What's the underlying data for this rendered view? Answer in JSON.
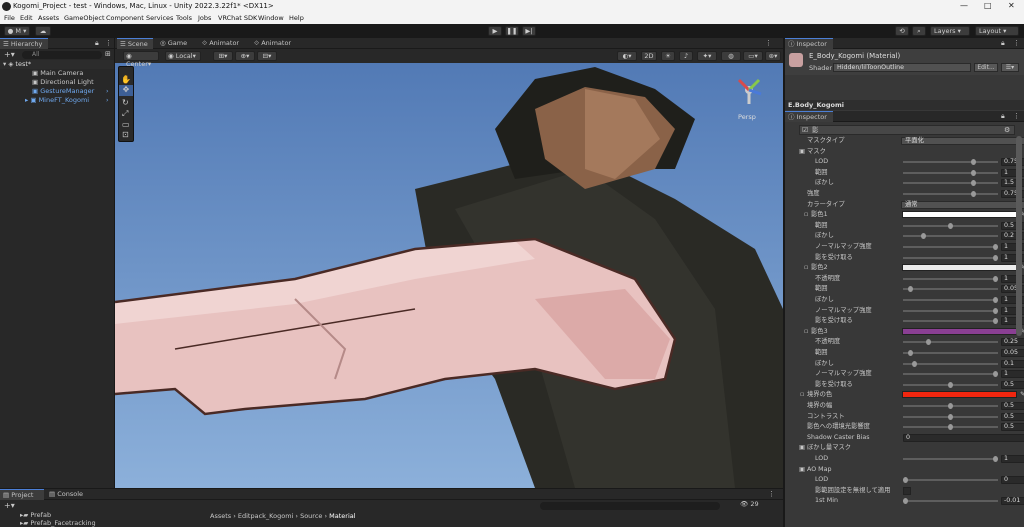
{
  "window": {
    "title": "Kogomi_Project - test - Windows, Mac, Linux - Unity 2022.3.22f1* <DX11>",
    "minimize": "—",
    "maximize": "□",
    "close": "✕"
  },
  "menu": [
    "File",
    "Edit",
    "Assets",
    "GameObject",
    "Component",
    "Services",
    "Tools",
    "Jobs",
    "VRChat SDK",
    "Window",
    "Help"
  ],
  "toolbar": {
    "account": "M",
    "layers": "Layers",
    "layout": "Layout"
  },
  "hierarchy": {
    "tab": "Hierarchy",
    "search_placeholder": "All",
    "items": [
      {
        "label": "test*",
        "indent": 0
      },
      {
        "label": "Main Camera",
        "indent": 1
      },
      {
        "label": "Directional Light",
        "indent": 1
      },
      {
        "label": "GestureManager",
        "indent": 1
      },
      {
        "label": "MineFT_Kogomi",
        "indent": 1
      }
    ]
  },
  "scene_tabs": [
    "Scene",
    "Game",
    "Animator",
    "Animator"
  ],
  "scene_toolbar": {
    "pivot": "Center",
    "space": "Local",
    "mode_2d": "2D",
    "persp": "Persp",
    "gizmo_count": "29"
  },
  "inspector_top": {
    "tab": "Inspector",
    "material_name": "E_Body_Kogomi (Material)",
    "shader_label": "Shader",
    "shader_value": "Hidden/lilToonOutline",
    "edit": "Edit...",
    "object_name": "E.Body_Kogomi"
  },
  "inspector": {
    "tab": "Inspector",
    "section": "影",
    "rows": [
      {
        "label": "マスクタイプ",
        "type": "dropdown",
        "value": "平面化",
        "indent": 1
      },
      {
        "label": "マスク",
        "type": "header",
        "indent": 1
      },
      {
        "label": "LOD",
        "type": "slider",
        "value": "0.75",
        "pos": 0.75,
        "indent": 3
      },
      {
        "label": "範囲",
        "type": "slider",
        "value": "1",
        "pos": 0.75,
        "indent": 3
      },
      {
        "label": "ぼかし",
        "type": "slider",
        "value": "1.5",
        "pos": 0.75,
        "indent": 3
      },
      {
        "label": "強度",
        "type": "slider",
        "value": "0.75",
        "pos": 0.75,
        "indent": 1
      },
      {
        "label": "カラータイプ",
        "type": "dropdown",
        "value": "通常",
        "indent": 1
      },
      {
        "label": "影色1",
        "type": "color",
        "color": "#ffffff",
        "indent": 2
      },
      {
        "label": "範囲",
        "type": "slider",
        "value": "0.5",
        "pos": 0.5,
        "indent": 3
      },
      {
        "label": "ぼかし",
        "type": "slider",
        "value": "0.2",
        "pos": 0.2,
        "indent": 3
      },
      {
        "label": "ノーマルマップ強度",
        "type": "slider",
        "value": "1",
        "pos": 1,
        "indent": 3
      },
      {
        "label": "影を受け取る",
        "type": "slider",
        "value": "1",
        "pos": 1,
        "indent": 3
      },
      {
        "label": "影色2",
        "type": "color",
        "color": "#ececec",
        "indent": 2
      },
      {
        "label": "不透明度",
        "type": "slider",
        "value": "1",
        "pos": 1,
        "indent": 3
      },
      {
        "label": "範囲",
        "type": "slider",
        "value": "0.05",
        "pos": 0.05,
        "indent": 3
      },
      {
        "label": "ぼかし",
        "type": "slider",
        "value": "1",
        "pos": 1,
        "indent": 3
      },
      {
        "label": "ノーマルマップ強度",
        "type": "slider",
        "value": "1",
        "pos": 1,
        "indent": 3
      },
      {
        "label": "影を受け取る",
        "type": "slider",
        "value": "1",
        "pos": 1,
        "indent": 3
      },
      {
        "label": "影色3",
        "type": "color",
        "color": "#8a3f93",
        "indent": 2
      },
      {
        "label": "不透明度",
        "type": "slider",
        "value": "0.25",
        "pos": 0.25,
        "indent": 3
      },
      {
        "label": "範囲",
        "type": "slider",
        "value": "0.05",
        "pos": 0.05,
        "indent": 3
      },
      {
        "label": "ぼかし",
        "type": "slider",
        "value": "0.1",
        "pos": 0.1,
        "indent": 3
      },
      {
        "label": "ノーマルマップ強度",
        "type": "slider",
        "value": "1",
        "pos": 1,
        "indent": 3
      },
      {
        "label": "影を受け取る",
        "type": "slider",
        "value": "0.5",
        "pos": 0.5,
        "indent": 3
      },
      {
        "label": "境界の色",
        "type": "color",
        "color": "#f2260f",
        "indent": 1
      },
      {
        "label": "境界の幅",
        "type": "slider",
        "value": "0.5",
        "pos": 0.5,
        "indent": 1
      },
      {
        "label": "コントラスト",
        "type": "slider",
        "value": "0.5",
        "pos": 0.5,
        "indent": 1
      },
      {
        "label": "影色への環境光影響度",
        "type": "slider",
        "value": "0.5",
        "pos": 0.5,
        "indent": 1
      },
      {
        "label": "Shadow Caster Bias",
        "type": "field",
        "value": "0",
        "indent": 1
      },
      {
        "label": "ぼかし量マスク",
        "type": "header",
        "indent": 1
      },
      {
        "label": "LOD",
        "type": "slider",
        "value": "1",
        "pos": 1,
        "indent": 3
      },
      {
        "label": "AO Map",
        "type": "header",
        "indent": 1
      },
      {
        "label": "LOD",
        "type": "slider",
        "value": "0",
        "pos": 0,
        "indent": 3
      },
      {
        "label": "影範囲設定を無視して適用",
        "type": "check",
        "indent": 3
      },
      {
        "label": "1st Min",
        "type": "slider",
        "value": "-0.01",
        "pos": 0,
        "indent": 3
      }
    ]
  },
  "project": {
    "tabs": [
      "Project",
      "Console"
    ],
    "folders": [
      "Prefab",
      "Prefab_Facetracking"
    ],
    "breadcrumb": [
      "Assets",
      "Editpack_Kogomi",
      "Source",
      "Material"
    ]
  },
  "colors": {
    "accent": "#4c7fd6",
    "prefab_blue": "#6fa8ee",
    "sky": "#5f86bd"
  }
}
